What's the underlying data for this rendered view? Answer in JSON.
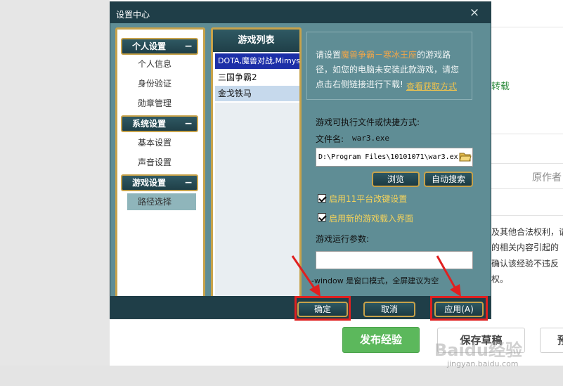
{
  "background": {
    "green_text": "转载",
    "author_label": "原作者",
    "text_lines": [
      "及其他合法权利，请",
      "的相关内容引起的",
      "确认该经验不违反",
      "权。"
    ],
    "publish_label": "发布经验",
    "save_label": "保存草稿",
    "next_label": "预",
    "watermark": "Baidu经验",
    "watermark_url": "jingyan.baidu.com"
  },
  "dialog": {
    "title": "设置中心",
    "close": "×",
    "nav": {
      "sections": [
        {
          "label": "个人设置",
          "items": [
            "个人信息",
            "身份验证",
            "勋章管理"
          ]
        },
        {
          "label": "系统设置",
          "items": [
            "基本设置",
            "声音设置"
          ]
        },
        {
          "label": "游戏设置",
          "items": [
            "路径选择"
          ]
        }
      ],
      "collapse_symbol": "−",
      "active_item": "路径选择"
    },
    "game_list": {
      "title": "游戏列表",
      "items": [
        "DOTA,魔兽对战,Mimys",
        "三国争霸2",
        "金戈铁马"
      ]
    },
    "info": {
      "prefix": "请设置",
      "game_name": "魔兽争霸－寒冰王座",
      "suffix": "的游戏路径，如您的电脑未安装此款游戏，请您点击右侧链接进行下载!",
      "link": "查看获取方式"
    },
    "exe_label": "游戏可执行文件或快捷方式:",
    "filename_label": "文件名:",
    "filename_value": "war3.exe",
    "path_value": "D:\\Program Files\\10101071\\war3.ex",
    "browse_label": "浏览",
    "auto_search_label": "自动搜索",
    "checkbox1": "启用11平台改键设置",
    "checkbox2": "启用新的游戏载入界面",
    "params_label": "游戏运行参数:",
    "hint": "-window 是窗口模式，全屏建议为空",
    "ok_label": "确定",
    "cancel_label": "取消",
    "apply_label": "应用(A)"
  },
  "colors": {
    "dialog_bg": "#5f8d95",
    "titlebar": "#1f3e48",
    "gold_border": "#c7a24a",
    "annotation_red": "#e02020",
    "publish_green": "#5cb85c"
  }
}
